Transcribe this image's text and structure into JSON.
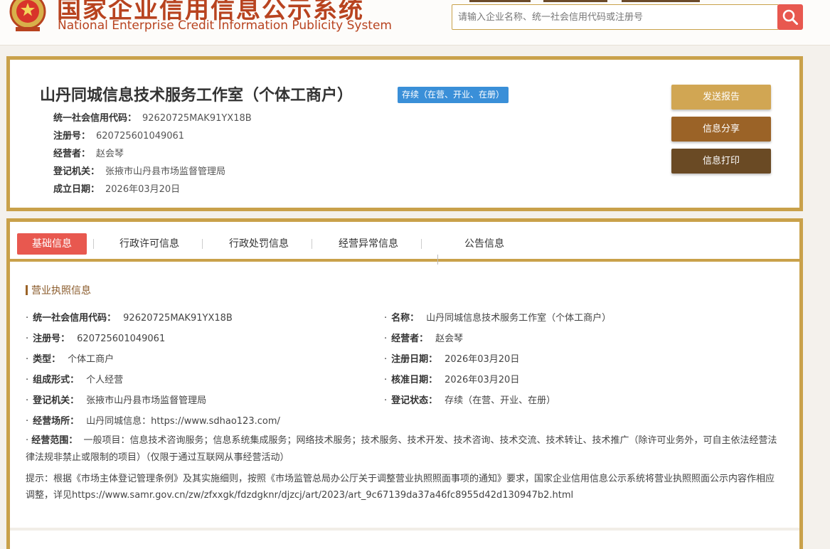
{
  "header": {
    "title_cn": "国家企业信用信息公示系统",
    "title_en": "National Enterprise Credit Information Publicity System",
    "search_placeholder": "请输入企业名称、统一社会信用代码或注册号"
  },
  "company": {
    "name": "山丹同城信息技术服务工作室（个体工商户）",
    "status": "存续（在营、开业、在册）",
    "summary": [
      {
        "label": "统一社会信用代码：",
        "value": "92620725MAK91YX18B"
      },
      {
        "label": "注册号：",
        "value": "620725601049061"
      },
      {
        "label": "经营者：",
        "value": "赵会琴"
      },
      {
        "label": "登记机关：",
        "value": "张掖市山丹县市场监督管理局"
      },
      {
        "label": "成立日期：",
        "value": "2026年03月20日"
      }
    ],
    "actions": {
      "report": "发送报告",
      "share": "信息分享",
      "print": "信息打印"
    }
  },
  "tabs": [
    "基础信息",
    "行政许可信息",
    "行政处罚信息",
    "经营异常信息",
    "公告信息"
  ],
  "license": {
    "section_title": "营业执照信息",
    "left": [
      {
        "label": "统一社会信用代码：",
        "value": "92620725MAK91YX18B"
      },
      {
        "label": "注册号：",
        "value": "620725601049061"
      },
      {
        "label": "类型：",
        "value": "个体工商户"
      },
      {
        "label": "组成形式：",
        "value": "个人经营"
      },
      {
        "label": "登记机关：",
        "value": "张掖市山丹县市场监督管理局"
      },
      {
        "label": "经营场所：",
        "value": "山丹同城信息：https://www.sdhao123.com/"
      }
    ],
    "right": [
      {
        "label": "名称：",
        "value": "山丹同城信息技术服务工作室（个体工商户）"
      },
      {
        "label": "经营者：",
        "value": "赵会琴"
      },
      {
        "label": "注册日期：",
        "value": "2026年03月20日"
      },
      {
        "label": "核准日期：",
        "value": "2026年03月20日"
      },
      {
        "label": "登记状态：",
        "value": "存续（在营、开业、在册）"
      }
    ],
    "scope_label": "经营范围：",
    "scope_value": "一般项目：信息技术咨询服务；信息系统集成服务；网络技术服务；技术服务、技术开发、技术咨询、技术交流、技术转让、技术推广（除许可业务外，可自主依法经营法律法规非禁止或限制的项目）（仅限于通过互联网从事经营活动）",
    "notice": "提示：根据《市场主体登记管理条例》及其实施细则，按照《市场监管总局办公厅关于调整营业执照照面事项的通知》要求，国家企业信用信息公示系统将营业执照照面公示内容作相应调整，详见https://www.samr.gov.cn/zw/zfxxgk/fdzdgknr/djzcj/art/2023/art_9c67139da37a46fc8955d42d130947b2.html"
  },
  "colors": {
    "gold_border": "#c9a14a",
    "accent_red": "#e8584f",
    "status_blue": "#3a8fd8",
    "brown_dark": "#6a4a24"
  }
}
